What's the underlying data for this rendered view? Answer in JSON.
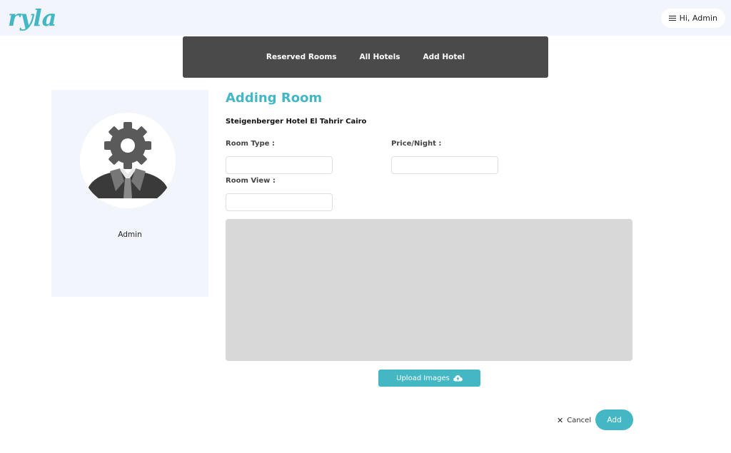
{
  "brand": {
    "logo_text": "ryla",
    "accent_color": "#43b7c4"
  },
  "header": {
    "greeting": "Hi, Admin",
    "menu_icon": "hamburger-icon"
  },
  "nav": {
    "items": [
      "Reserved Rooms",
      "All Hotels",
      "Add Hotel"
    ]
  },
  "profile": {
    "name": "Admin",
    "avatar_icon": "admin-gear-avatar-icon"
  },
  "form": {
    "title": "Adding Room",
    "hotel_name": "Steigenberger Hotel El Tahrir Cairo",
    "room_type_label": "Room Type :",
    "price_label": "Price/Night :",
    "room_view_label": "Room View :",
    "room_type_value": "",
    "price_value": "",
    "room_view_value": ""
  },
  "actions": {
    "upload_label": "Upload Images",
    "upload_icon": "cloud-upload-icon",
    "cancel_label": "Cancel",
    "cancel_icon": "close-icon",
    "add_label": "Add"
  }
}
